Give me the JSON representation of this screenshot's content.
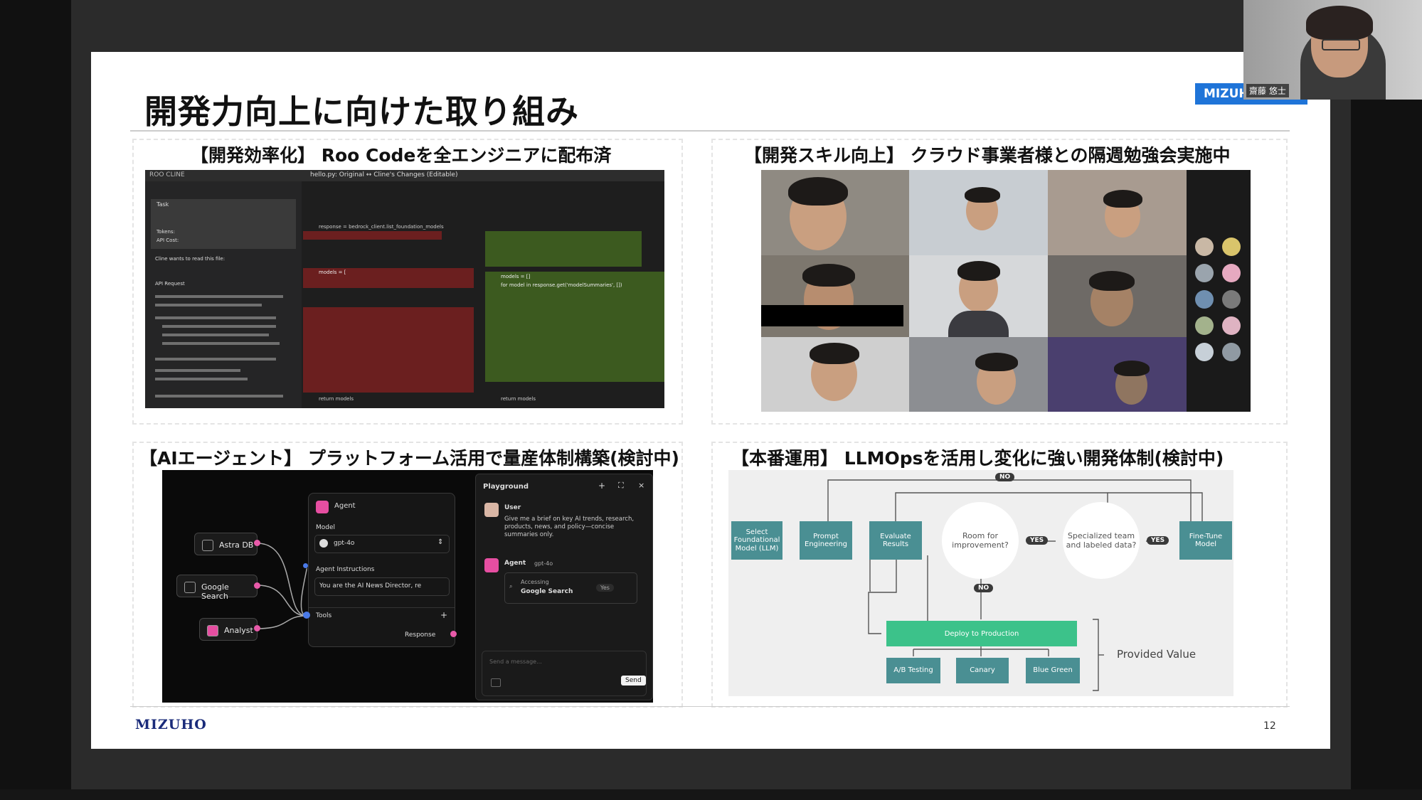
{
  "slide": {
    "title": "開発力向上に向けた取り組み",
    "page_number": "12",
    "logo": "MIZUHO"
  },
  "panels": [
    {
      "heading": "【開発効率化】 Roo Codeを全エンジニアに配布済"
    },
    {
      "heading": "【開発スキル向上】 クラウド事業者様との隔週勉強会実施中"
    },
    {
      "heading": "【AIエージェント】 プラットフォーム活用で量産体制構築(検討中)"
    },
    {
      "heading": "【本番運用】 LLMOpsを活用し変化に強い開発体制(検討中)"
    }
  ],
  "code_screenshot": {
    "sidebar_title": "ROO CLINE",
    "tab_label": "hello.py: Original ↔ Cline's Changes (Editable)",
    "task_label": "Task",
    "tokens_label": "Tokens:",
    "api_cost_label": "API Cost:",
    "read_file_label": "Cline wants to read this file:",
    "api_request_label": "API Request",
    "left_code": [
      "models = [",
      "response = bedrock_client.list_foundation_models",
      "return models"
    ],
    "right_code": [
      "models = []",
      "for model in response.get('modelSummaries', [])",
      "return models"
    ]
  },
  "agent_flow": {
    "nodes": [
      "Astra DB",
      "Google Search",
      "Analyst"
    ],
    "agent_title": "Agent",
    "model_label": "Model",
    "model_value": "gpt-4o",
    "instructions_label": "Agent Instructions",
    "instructions_value": "You are the AI News Director, re",
    "tools_label": "Tools",
    "response_label": "Response",
    "playground_title": "Playground",
    "user_label": "User",
    "user_message": "Give me a brief on key AI trends, research, products, news, and policy—concise summaries only.",
    "agent_label": "Agent",
    "agent_model": "gpt-4o",
    "accessing_label": "Accessing",
    "accessing_value": "Google Search",
    "accessing_status": "Yes",
    "message_placeholder": "Send a message...",
    "send_label": "Send"
  },
  "llmops_flow": {
    "boxes": [
      "Select Foundational Model (LLM)",
      "Prompt Engineering",
      "Evaluate Results",
      "Fine-Tune Model"
    ],
    "circles": [
      "Room for improvement?",
      "Specialized team and labeled data?"
    ],
    "yes_label": "YES",
    "no_label": "NO",
    "deploy_label": "Deploy to Production",
    "outcomes": [
      "A/B Testing",
      "Canary",
      "Blue Green"
    ],
    "provided_value": "Provided Value"
  },
  "webcam": {
    "name": "齋藤 悠士",
    "badge": "MIZUHO"
  },
  "colors": {
    "mizuho_blue": "#1a2b7a",
    "badge_blue": "#1f74d8",
    "flow_teal": "#4a8f93",
    "deploy_green": "#3cc28a",
    "node_pink": "#e64ea1"
  }
}
